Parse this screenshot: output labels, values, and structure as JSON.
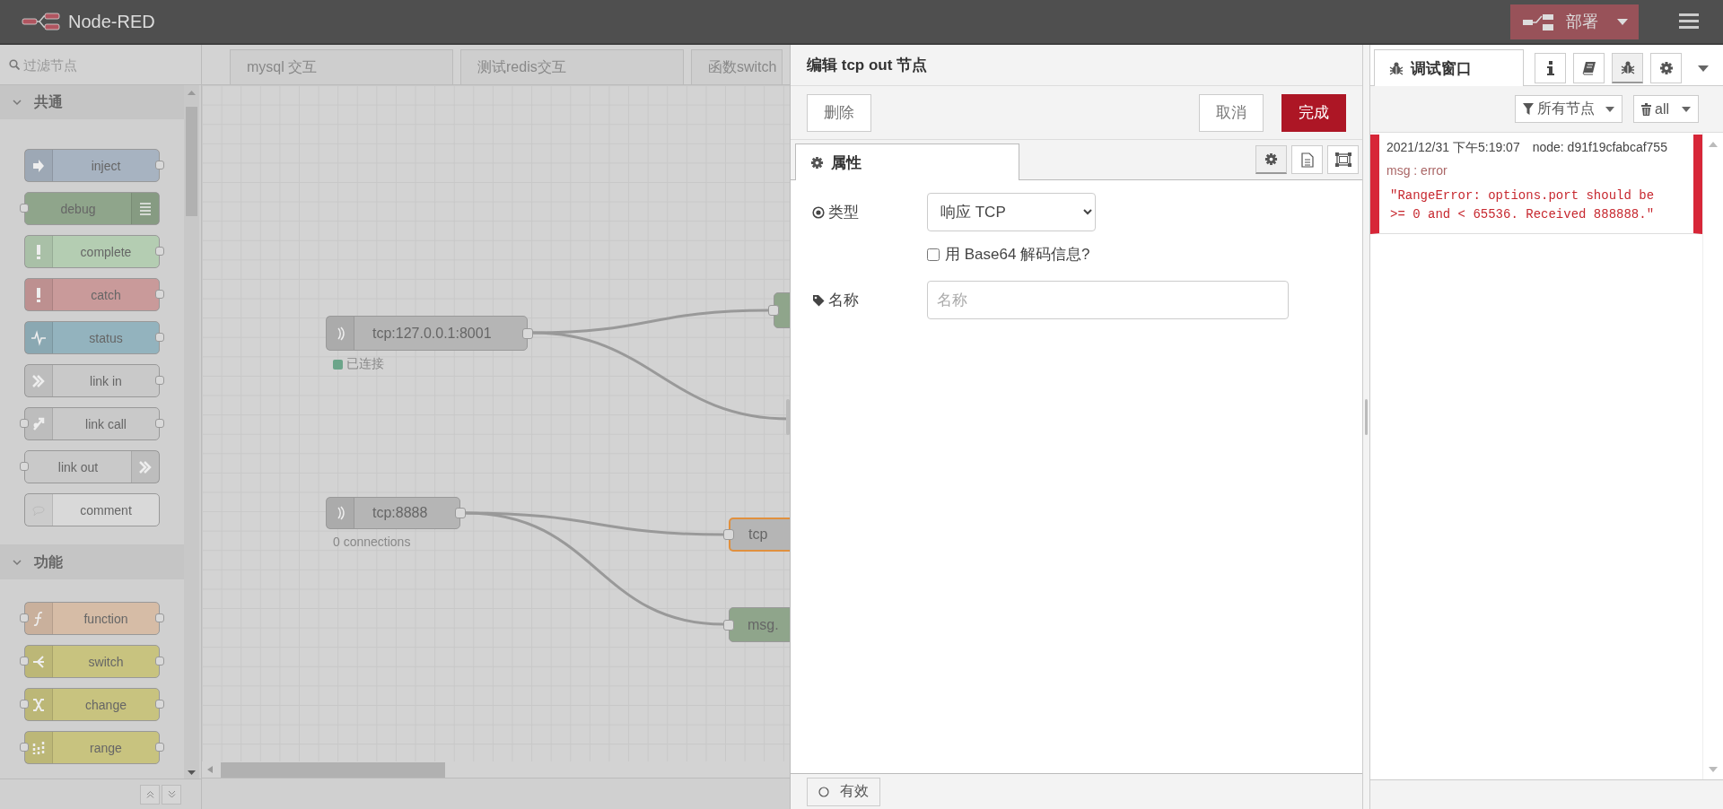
{
  "header": {
    "title": "Node-RED",
    "deploy_label": "部署"
  },
  "palette": {
    "filter_placeholder": "过滤节点",
    "categories": [
      {
        "label": "共通",
        "expanded": true,
        "nodes": [
          {
            "label": "inject",
            "kind": "inject",
            "color": "#a7b3c1",
            "input": false,
            "output": true
          },
          {
            "label": "debug",
            "kind": "debug",
            "color": "#8fa58b",
            "input": true,
            "output": false
          },
          {
            "label": "complete",
            "kind": "complete",
            "color": "#b4cdb2",
            "input": false,
            "output": true
          },
          {
            "label": "catch",
            "kind": "catch",
            "color": "#c99a9a",
            "input": false,
            "output": true
          },
          {
            "label": "status",
            "kind": "status",
            "color": "#93b3be",
            "input": false,
            "output": true
          },
          {
            "label": "link in",
            "kind": "link-in",
            "color": "#c9c9c9",
            "input": false,
            "output": true
          },
          {
            "label": "link call",
            "kind": "link-call",
            "color": "#c9c9c9",
            "input": true,
            "output": true
          },
          {
            "label": "link out",
            "kind": "link-out",
            "color": "#c9c9c9",
            "input": true,
            "output": false
          },
          {
            "label": "comment",
            "kind": "comment",
            "color": "#d9d9d9",
            "input": false,
            "output": false
          }
        ]
      },
      {
        "label": "功能",
        "expanded": true,
        "nodes": [
          {
            "label": "function",
            "kind": "function",
            "color": "#d6bca6",
            "input": true,
            "output": true
          },
          {
            "label": "switch",
            "kind": "switch",
            "color": "#c8c37f",
            "input": true,
            "output": true
          },
          {
            "label": "change",
            "kind": "change",
            "color": "#c8c37f",
            "input": true,
            "output": true
          },
          {
            "label": "range",
            "kind": "range",
            "color": "#c8c37f",
            "input": true,
            "output": true
          }
        ]
      }
    ]
  },
  "workspace": {
    "tabs": [
      {
        "label": "mysql 交互",
        "selected": false
      },
      {
        "label": "测试redis交互",
        "selected": false
      },
      {
        "label": "函数switch",
        "selected": false
      }
    ],
    "nodes": [
      {
        "label": "tcp:127.0.0.1:8001",
        "kind": "tcp-in",
        "color": "#b5b5b5",
        "selected": false,
        "status": {
          "text": "已连接",
          "color": "#6ca58a"
        }
      },
      {
        "kind": "plain",
        "color": "#8fa58b",
        "selected": false
      },
      {
        "label": "tcp:8888",
        "kind": "tcp-in",
        "color": "#b5b5b5",
        "selected": false,
        "status": {
          "text": "0 connections"
        }
      },
      {
        "label": "tcp",
        "kind": "plain",
        "color": "#b5b5b5",
        "selected": true
      },
      {
        "label": "msg.",
        "kind": "plain",
        "color": "#8fa58b",
        "selected": false
      }
    ]
  },
  "editor": {
    "title": "编辑 tcp out 节点",
    "delete_label": "删除",
    "cancel_label": "取消",
    "done_label": "完成",
    "tabs": [
      {
        "label": "属性",
        "selected": true
      }
    ],
    "tab_icons": [
      {
        "kind": "gear",
        "selected": true
      },
      {
        "kind": "doc",
        "selected": false
      },
      {
        "kind": "frame",
        "selected": false
      }
    ],
    "fields": [
      {
        "kind": "select",
        "label": "类型",
        "value": "响应 TCP"
      },
      {
        "kind": "checkbox",
        "label": "用 Base64 解码信息?",
        "checked": false
      },
      {
        "kind": "text",
        "label": "名称",
        "placeholder": "名称"
      }
    ],
    "enabled_label": "有效"
  },
  "sidebar": {
    "tabs": [
      {
        "label": "调试窗口",
        "selected": true
      }
    ],
    "tab_icons": [
      {
        "kind": "info",
        "selected": false
      },
      {
        "kind": "book",
        "selected": false
      },
      {
        "kind": "bug",
        "selected": true
      },
      {
        "kind": "gear",
        "selected": false
      }
    ],
    "filter_label": "所有节点",
    "clear_label": "all",
    "messages": [
      {
        "time": "2021/12/31 下午5:19:07",
        "node": "node: d91f19cfabcaf755",
        "topic": "msg : error",
        "payload": "\"RangeError: options.port should be >= 0 and < 65536. Received 888888.\""
      }
    ]
  }
}
